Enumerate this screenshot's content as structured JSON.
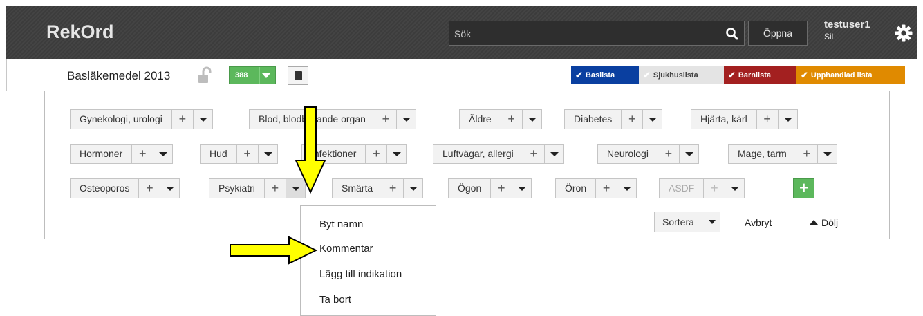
{
  "app": {
    "title": "RekOrd"
  },
  "header": {
    "search_placeholder": "Sök",
    "open_label": "Öppna",
    "user_name": "testuser1",
    "user_sub": "Sil"
  },
  "list_bar": {
    "title": "Basläkemedel 2013",
    "count": "388",
    "filters": [
      {
        "label": "Baslista",
        "color": "#0a3fa0"
      },
      {
        "label": "Sjukhuslista",
        "color": "#e4e4e4"
      },
      {
        "label": "Barnlista",
        "color": "#a32020"
      },
      {
        "label": "Upphandlad lista",
        "color": "#e08a00"
      }
    ]
  },
  "categories": [
    {
      "label": "Gynekologi, urologi"
    },
    {
      "label": "Blod, blodbildande organ"
    },
    {
      "label": "Äldre"
    },
    {
      "label": "Diabetes"
    },
    {
      "label": "Hjärta, kärl"
    },
    {
      "label": "Hormoner"
    },
    {
      "label": "Hud"
    },
    {
      "label": "Infektioner"
    },
    {
      "label": "Luftvägar, allergi"
    },
    {
      "label": "Neurologi"
    },
    {
      "label": "Mage, tarm"
    },
    {
      "label": "Osteoporos"
    },
    {
      "label": "Psykiatri"
    },
    {
      "label": "Smärta"
    },
    {
      "label": "Ögon"
    },
    {
      "label": "Öron"
    },
    {
      "label": "ASDF"
    }
  ],
  "plus_glyph": "+",
  "add_glyph": "+",
  "actions": {
    "sort": "Sortera",
    "cancel": "Avbryt",
    "hide": "Dölj"
  },
  "context_menu": {
    "items": [
      {
        "label": "Byt namn"
      },
      {
        "label": "Kommentar"
      },
      {
        "label": "Lägg till indikation"
      },
      {
        "label": "Ta bort"
      }
    ]
  },
  "annotation_color": "#ffff00"
}
